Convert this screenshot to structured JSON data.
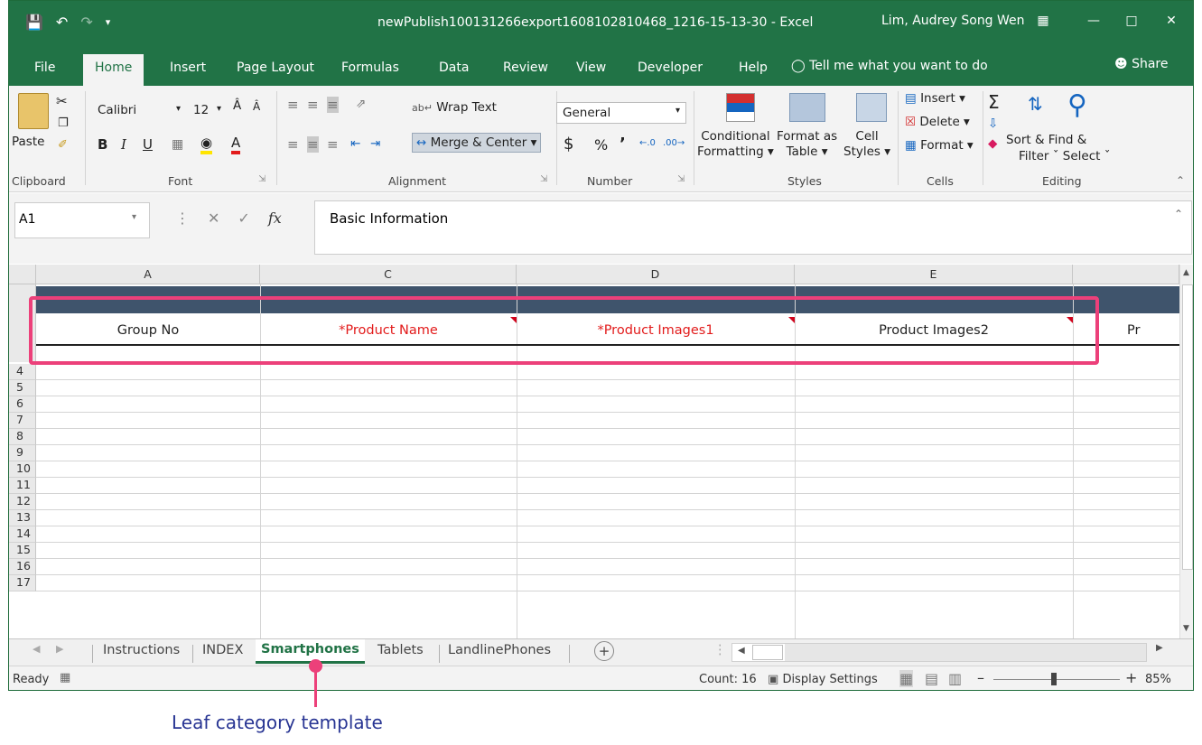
{
  "titlebar": {
    "save_icon": "save-icon",
    "undo_icon": "undo-icon",
    "redo_icon": "redo-icon",
    "doc_title": "newPublish100131266export1608102810468_1216-15-13-30  -  Excel",
    "user": "Lim, Audrey Song Wen"
  },
  "tabs": [
    "File",
    "Home",
    "Insert",
    "Page Layout",
    "Formulas",
    "Data",
    "Review",
    "View",
    "Developer",
    "Help"
  ],
  "tell_me": "Tell me what you want to do",
  "share": "Share",
  "ribbon": {
    "paste": "Paste",
    "clipboard": "Clipboard",
    "font_name": "Calibri",
    "font_size": "12",
    "font": "Font",
    "bold": "B",
    "italic": "I",
    "underline": "U",
    "wrap_text": "Wrap Text",
    "merge_center": "Merge & Center",
    "alignment": "Alignment",
    "number_format": "General",
    "currency": "$",
    "percent": "%",
    "comma": "’",
    "number": "Number",
    "conditional": "Conditional",
    "formatting": "Formatting",
    "format_as": "Format as",
    "table": "Table",
    "cell": "Cell",
    "styles_btn": "Styles",
    "styles": "Styles",
    "insert": "Insert",
    "delete": "Delete",
    "format": "Format",
    "cells": "Cells",
    "sort_find": "Sort & Find &",
    "filter_select": "Filter ˇ Select ˇ",
    "editing": "Editing"
  },
  "formula": {
    "name_box": "A1",
    "content": "Basic Information"
  },
  "grid": {
    "columns": [
      "A",
      "C",
      "D",
      "E"
    ],
    "rows": [
      "4",
      "5",
      "6",
      "7",
      "8",
      "9",
      "10",
      "11",
      "12",
      "13",
      "14",
      "15",
      "16",
      "17"
    ],
    "header_cells": [
      {
        "text": "Group No",
        "color": "#222222"
      },
      {
        "text": "*Product Name",
        "color": "#e21b1b"
      },
      {
        "text": "*Product Images1",
        "color": "#e21b1b"
      },
      {
        "text": "Product Images2",
        "color": "#222222"
      },
      {
        "text": "Pr",
        "color": "#222222"
      }
    ]
  },
  "sheets": [
    "Instructions",
    "INDEX",
    "Smartphones",
    "Tablets",
    "LandlinePhones"
  ],
  "status": {
    "ready": "Ready",
    "count": "Count: 16",
    "display_settings": "Display Settings",
    "zoom": "85%"
  },
  "caption": "Leaf category template",
  "colors": {
    "accent": "#217346",
    "highlight": "#ec407a",
    "band": "#3f546c"
  }
}
